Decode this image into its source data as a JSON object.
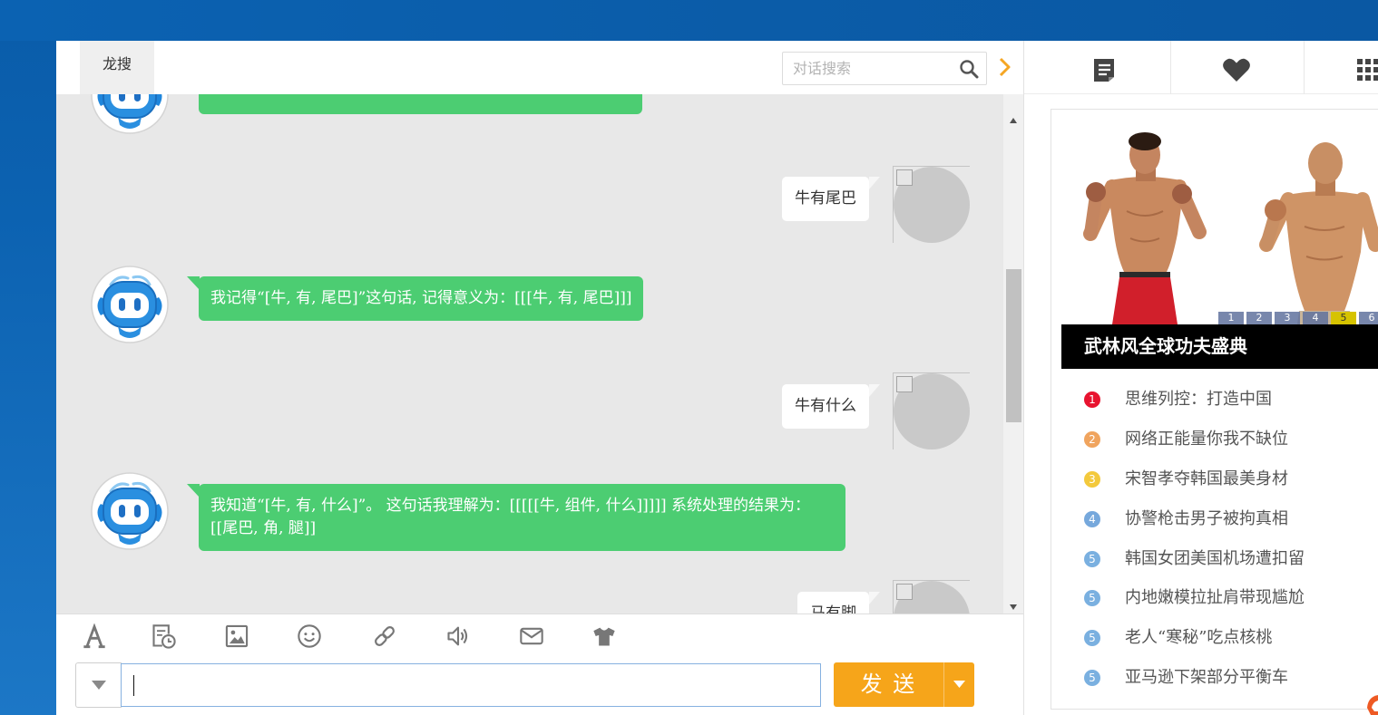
{
  "header": {
    "tab_label": "龙搜",
    "search_placeholder": "对话搜索"
  },
  "chat": {
    "messages": [
      {
        "from_user": true,
        "text": "牛有尾巴"
      },
      {
        "from_user": false,
        "text": "我记得“[牛, 有, 尾巴]”这句话, 记得意义为：[[[牛, 有, 尾巴]]]"
      },
      {
        "from_user": true,
        "text": "牛有什么"
      },
      {
        "from_user": false,
        "text": "我知道“[牛, 有, 什么]”。 这句话我理解为：[[[[[牛, 组件, 什么]]]]] 系统处理的结果为： [[尾巴, 角, 腿]]"
      },
      {
        "from_user": true,
        "text": "马有脚"
      }
    ]
  },
  "toolbar": {
    "icons": [
      "font-icon",
      "history-icon",
      "image-icon",
      "emoji-icon",
      "link-icon",
      "volume-icon",
      "mail-icon",
      "theme-icon"
    ]
  },
  "composer": {
    "input_value": "",
    "send_label": "发 送"
  },
  "sidebar": {
    "tab_icons": [
      "document-icon",
      "heart-icon",
      "grid-icon"
    ],
    "banner": {
      "caption": "武林风全球功夫盛典",
      "pages": [
        {
          "label": "1",
          "active": false
        },
        {
          "label": "2",
          "active": false
        },
        {
          "label": "3",
          "active": false
        },
        {
          "label": "4",
          "active": false
        },
        {
          "label": "5",
          "active": true
        },
        {
          "label": "6",
          "active": false
        }
      ]
    },
    "hot_list": [
      {
        "rank": "1",
        "title": "思维列控：打造中国",
        "color": "#e8132f"
      },
      {
        "rank": "2",
        "title": "网络正能量你我不缺位",
        "color": "#f0a45e"
      },
      {
        "rank": "3",
        "title": "宋智孝夺韩国最美身材",
        "color": "#f3c93c"
      },
      {
        "rank": "4",
        "title": "协警枪击男子被拘真相",
        "color": "#76a8dc"
      },
      {
        "rank": "5",
        "title": "韩国女团美国机场遭扣留",
        "color": "#7ab0e0"
      },
      {
        "rank": "5",
        "title": "内地嫩模拉扯肩带现尴尬",
        "color": "#7ab0e0"
      },
      {
        "rank": "5",
        "title": "老人“寒秘”吃点核桃",
        "color": "#7ab0e0"
      },
      {
        "rank": "5",
        "title": "亚马逊下架部分平衡车",
        "color": "#7ab0e0"
      }
    ]
  },
  "colors": {
    "bot_bubble": "#4ccd72",
    "send_button": "#f6a51a",
    "chevron": "#f5a623",
    "icon_gray": "#777777"
  }
}
